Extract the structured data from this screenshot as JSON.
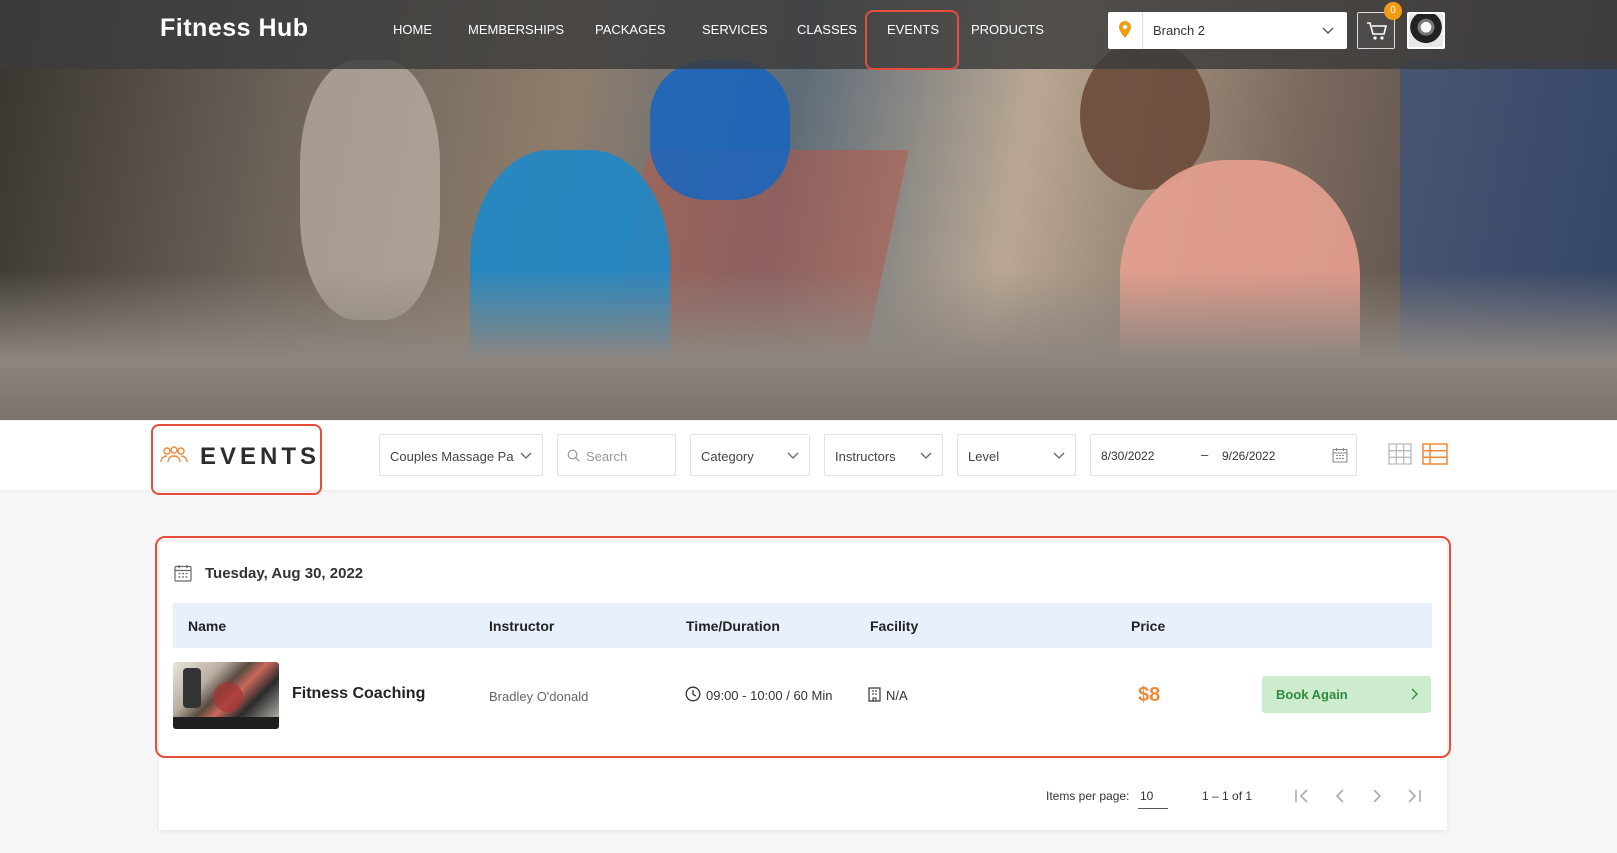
{
  "brand": "Fitness Hub",
  "nav": {
    "home": "HOME",
    "memberships": "MEMBERSHIPS",
    "packages": "PACKAGES",
    "services": "SERVICES",
    "classes": "CLASSES",
    "events": "EVENTS",
    "products": "PRODUCTS",
    "active": "EVENTS"
  },
  "branch": {
    "value": "Branch 2",
    "icon": "location-pin-icon"
  },
  "cart": {
    "count": "0",
    "icon": "cart-icon"
  },
  "page": {
    "title": "EVENTS",
    "icon": "group-people-icon"
  },
  "filters": {
    "event_select": "Couples Massage Pa",
    "search_placeholder": "Search",
    "category": "Category",
    "instructors": "Instructors",
    "level": "Level",
    "date_from": "8/30/2022",
    "date_sep": "–",
    "date_to": "9/26/2022"
  },
  "day": {
    "label": "Tuesday, Aug 30, 2022"
  },
  "table": {
    "headers": {
      "name": "Name",
      "instructor": "Instructor",
      "time": "Time/Duration",
      "facility": "Facility",
      "price": "Price"
    },
    "rows": [
      {
        "name": "Fitness Coaching",
        "instructor": "Bradley O'donald",
        "time": "09:00 - 10:00 / 60 Min",
        "facility": "N/A",
        "price": "$8",
        "action": "Book Again"
      }
    ]
  },
  "pagination": {
    "items_per_page_label": "Items per page:",
    "page_size": "10",
    "range": "1 – 1 of 1"
  },
  "colors": {
    "accent": "#f0883a",
    "highlight": "#e74c3c",
    "book_bg": "#cdeccd",
    "book_text": "#2e8b3e",
    "header_bg": "#e8f0fb"
  }
}
